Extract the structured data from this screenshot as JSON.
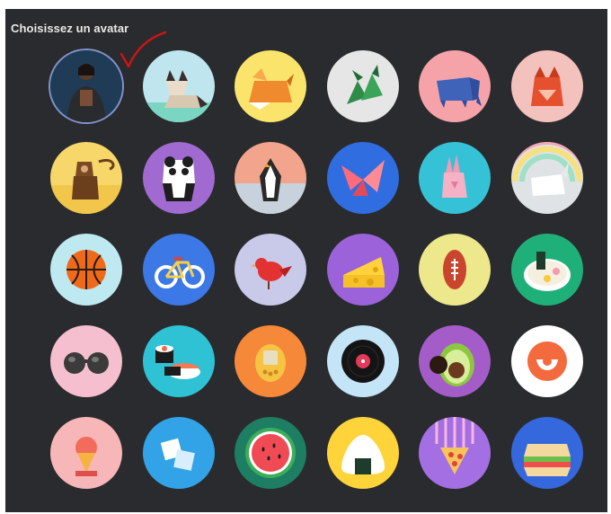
{
  "dialog": {
    "title": "Choisissez un avatar"
  },
  "avatars": [
    {
      "name": "avatar-photo-user",
      "icon": "photo",
      "bg": "#1f3b57",
      "selected": true
    },
    {
      "name": "avatar-origami-cat",
      "icon": "cat",
      "bg": "#bfe6ef"
    },
    {
      "name": "avatar-origami-fox",
      "icon": "fox",
      "bg": "#fbe46b"
    },
    {
      "name": "avatar-origami-dragon",
      "icon": "dragon",
      "bg": "#e6e6e6"
    },
    {
      "name": "avatar-origami-elephant",
      "icon": "elephant",
      "bg": "#f5a3a8"
    },
    {
      "name": "avatar-origami-red-fox",
      "icon": "redfox",
      "bg": "#f4c2bc"
    },
    {
      "name": "avatar-origami-monkey",
      "icon": "monkey",
      "bg": "#f7d66a"
    },
    {
      "name": "avatar-origami-panda",
      "icon": "panda",
      "bg": "#a06ad1"
    },
    {
      "name": "avatar-origami-penguin",
      "icon": "penguin",
      "bg": "#f2a58c"
    },
    {
      "name": "avatar-origami-butterfly",
      "icon": "butterfly",
      "bg": "#2f6de0"
    },
    {
      "name": "avatar-origami-rabbit",
      "icon": "rabbit",
      "bg": "#36c2d6"
    },
    {
      "name": "avatar-origami-unicorn",
      "icon": "unicorn",
      "bg": "#dfe3e6"
    },
    {
      "name": "avatar-basketball",
      "icon": "basketball",
      "bg": "#bfe9f0"
    },
    {
      "name": "avatar-bicycle",
      "icon": "bicycle",
      "bg": "#3c78e6"
    },
    {
      "name": "avatar-bird",
      "icon": "bird",
      "bg": "#c9c9ea"
    },
    {
      "name": "avatar-cheese",
      "icon": "cheese",
      "bg": "#9b62d9"
    },
    {
      "name": "avatar-football",
      "icon": "football",
      "bg": "#ede88c"
    },
    {
      "name": "avatar-ramen",
      "icon": "ramen",
      "bg": "#1fb079"
    },
    {
      "name": "avatar-sunglasses",
      "icon": "sunglasses",
      "bg": "#f6bfd0"
    },
    {
      "name": "avatar-sushi",
      "icon": "sushi",
      "bg": "#2fc1d4"
    },
    {
      "name": "avatar-tamagotchi",
      "icon": "tamagotchi",
      "bg": "#f6883a"
    },
    {
      "name": "avatar-vinyl",
      "icon": "vinyl",
      "bg": "#c4e4f7"
    },
    {
      "name": "avatar-avocado",
      "icon": "avocado",
      "bg": "#a45cc9"
    },
    {
      "name": "avatar-smile",
      "icon": "smile",
      "bg": "#ffffff"
    },
    {
      "name": "avatar-ice-cream",
      "icon": "icecream",
      "bg": "#f7b6b8"
    },
    {
      "name": "avatar-sugar-cubes",
      "icon": "cubes",
      "bg": "#32a3e6"
    },
    {
      "name": "avatar-watermelon",
      "icon": "watermelon",
      "bg": "#1d7e63"
    },
    {
      "name": "avatar-onigiri",
      "icon": "onigiri",
      "bg": "#ffd43b"
    },
    {
      "name": "avatar-pizza",
      "icon": "pizza",
      "bg": "#a36fe3"
    },
    {
      "name": "avatar-sandwich",
      "icon": "sandwich",
      "bg": "#3468dc"
    }
  ]
}
